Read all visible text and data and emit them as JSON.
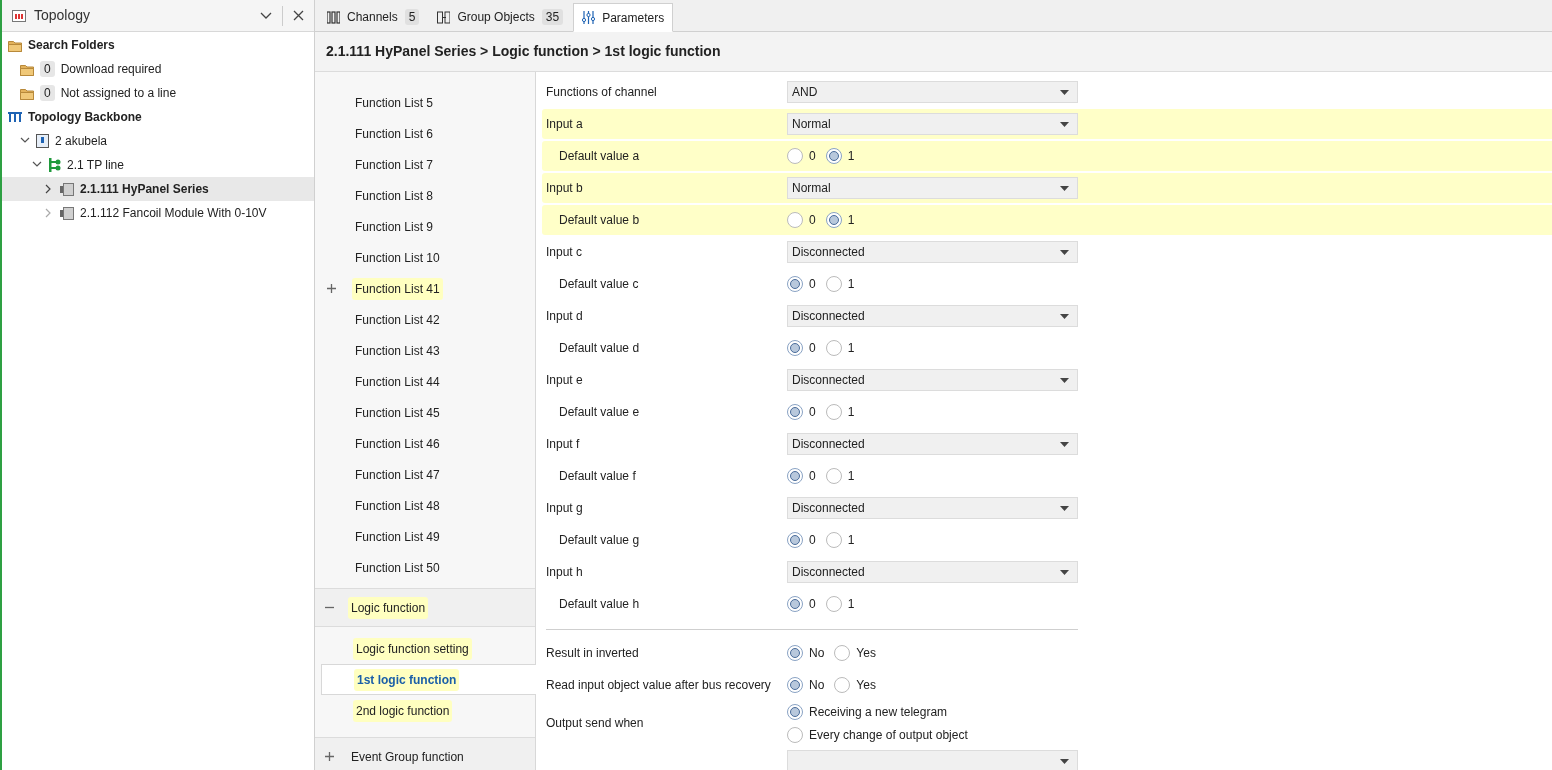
{
  "panel": {
    "title": "Topology"
  },
  "tree": [
    {
      "kind": "folder",
      "label": "Search Folders",
      "children": [
        {
          "kind": "folder",
          "label": "Download required",
          "count": "0"
        },
        {
          "kind": "folder",
          "label": "Not assigned to a line",
          "count": "0"
        }
      ]
    },
    {
      "kind": "backbone",
      "label": "Topology Backbone",
      "children": [
        {
          "kind": "area",
          "label": "2 akubela",
          "expanded": true,
          "selected": false,
          "children": [
            {
              "kind": "line",
              "label": "2.1 TP line",
              "expanded": true,
              "selected": false,
              "children": [
                {
                  "kind": "device",
                  "label": "2.1.111 HyPanel Series",
                  "expanded": false,
                  "selected": true
                },
                {
                  "kind": "device",
                  "label": "2.1.112 Fancoil Module With 0-10V",
                  "expanded": false,
                  "selected": false
                }
              ]
            }
          ]
        }
      ]
    }
  ],
  "tabs": [
    {
      "kind": "channels",
      "label": "Channels",
      "count": "5",
      "selected": false
    },
    {
      "kind": "objects",
      "label": "Group Objects",
      "count": "35",
      "selected": false
    },
    {
      "kind": "parameters",
      "label": "Parameters",
      "selected": true
    }
  ],
  "breadcrumb": "2.1.111 HyPanel Series > Logic function > 1st logic function",
  "nav": [
    {
      "label": "Function List 5",
      "highlighted": false
    },
    {
      "label": "Function List 6",
      "highlighted": false
    },
    {
      "label": "Function List 7",
      "highlighted": false
    },
    {
      "label": "Function List 8",
      "highlighted": false
    },
    {
      "label": "Function List 9",
      "highlighted": false
    },
    {
      "label": "Function List 10",
      "highlighted": false
    },
    {
      "label": "Function List 41",
      "highlighted": true,
      "expanded": false
    },
    {
      "label": "Function List 42",
      "highlighted": false
    },
    {
      "label": "Function List 43",
      "highlighted": false
    },
    {
      "label": "Function List 44",
      "highlighted": false
    },
    {
      "label": "Function List 45",
      "highlighted": false
    },
    {
      "label": "Function List 46",
      "highlighted": false
    },
    {
      "label": "Function List 47",
      "highlighted": false
    },
    {
      "label": "Function List 48",
      "highlighted": false
    },
    {
      "label": "Function List 49",
      "highlighted": false
    },
    {
      "label": "Function List 50",
      "highlighted": false
    }
  ],
  "nav_groups": [
    {
      "label": "Logic function",
      "highlighted": true,
      "expanded": true,
      "children": [
        {
          "label": "Logic function setting",
          "highlighted": true,
          "selected": false
        },
        {
          "label": "1st logic function",
          "highlighted": true,
          "selected": true
        },
        {
          "label": "2nd logic function",
          "highlighted": true,
          "selected": false
        }
      ]
    },
    {
      "label": "Event Group function",
      "highlighted": false,
      "expanded": false
    }
  ],
  "params": [
    {
      "kind": "dropdown",
      "label": "Functions of channel",
      "value": "AND",
      "highlighted": false
    },
    {
      "kind": "dropdown",
      "label": "Input a",
      "value": "Normal",
      "highlighted": true,
      "children": [
        {
          "kind": "radio",
          "label": "Default value a",
          "highlighted": true,
          "options": [
            {
              "label": "0",
              "selected": false
            },
            {
              "label": "1",
              "selected": true
            }
          ]
        }
      ]
    },
    {
      "kind": "dropdown",
      "label": "Input b",
      "value": "Normal",
      "highlighted": true,
      "children": [
        {
          "kind": "radio",
          "label": "Default value b",
          "highlighted": true,
          "options": [
            {
              "label": "0",
              "selected": false
            },
            {
              "label": "1",
              "selected": true
            }
          ]
        }
      ]
    },
    {
      "kind": "dropdown",
      "label": "Input c",
      "value": "Disconnected",
      "highlighted": false,
      "children": [
        {
          "kind": "radio",
          "label": "Default value c",
          "highlighted": false,
          "options": [
            {
              "label": "0",
              "selected": true
            },
            {
              "label": "1",
              "selected": false
            }
          ]
        }
      ]
    },
    {
      "kind": "dropdown",
      "label": "Input d",
      "value": "Disconnected",
      "highlighted": false,
      "children": [
        {
          "kind": "radio",
          "label": "Default value d",
          "highlighted": false,
          "options": [
            {
              "label": "0",
              "selected": true
            },
            {
              "label": "1",
              "selected": false
            }
          ]
        }
      ]
    },
    {
      "kind": "dropdown",
      "label": "Input e",
      "value": "Disconnected",
      "highlighted": false,
      "children": [
        {
          "kind": "radio",
          "label": "Default value e",
          "highlighted": false,
          "options": [
            {
              "label": "0",
              "selected": true
            },
            {
              "label": "1",
              "selected": false
            }
          ]
        }
      ]
    },
    {
      "kind": "dropdown",
      "label": "Input f",
      "value": "Disconnected",
      "highlighted": false,
      "children": [
        {
          "kind": "radio",
          "label": "Default value f",
          "highlighted": false,
          "options": [
            {
              "label": "0",
              "selected": true
            },
            {
              "label": "1",
              "selected": false
            }
          ]
        }
      ]
    },
    {
      "kind": "dropdown",
      "label": "Input g",
      "value": "Disconnected",
      "highlighted": false,
      "children": [
        {
          "kind": "radio",
          "label": "Default value g",
          "highlighted": false,
          "options": [
            {
              "label": "0",
              "selected": true
            },
            {
              "label": "1",
              "selected": false
            }
          ]
        }
      ]
    },
    {
      "kind": "dropdown",
      "label": "Input h",
      "value": "Disconnected",
      "highlighted": false,
      "children": [
        {
          "kind": "radio",
          "label": "Default value h",
          "highlighted": false,
          "options": [
            {
              "label": "0",
              "selected": true
            },
            {
              "label": "1",
              "selected": false
            }
          ]
        }
      ]
    },
    {
      "kind": "divider"
    },
    {
      "kind": "radio",
      "label": "Result in inverted",
      "highlighted": false,
      "options": [
        {
          "label": "No",
          "selected": true
        },
        {
          "label": "Yes",
          "selected": false
        }
      ]
    },
    {
      "kind": "radio",
      "label": "Read input object value after bus recovery",
      "highlighted": false,
      "options": [
        {
          "label": "No",
          "selected": true
        },
        {
          "label": "Yes",
          "selected": false
        }
      ]
    },
    {
      "kind": "radio-list",
      "label": "Output send when",
      "highlighted": false,
      "options": [
        {
          "label": "Receiving a new telegram",
          "selected": true
        },
        {
          "label": "Every change of output object",
          "selected": false
        }
      ]
    },
    {
      "kind": "dropdown"
    }
  ]
}
